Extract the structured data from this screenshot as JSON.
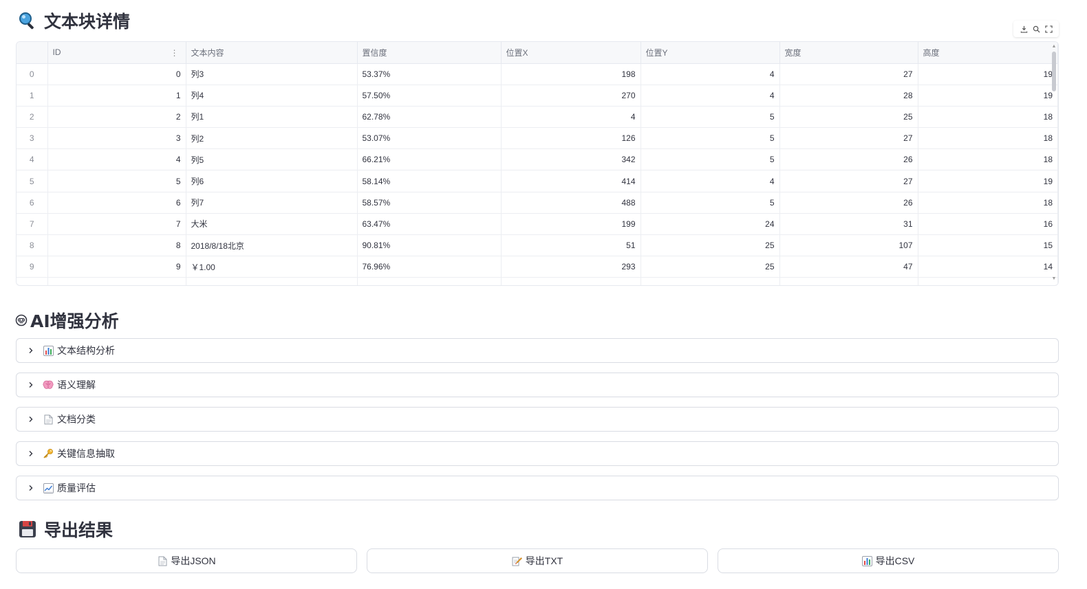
{
  "sections": {
    "blocks_title": "文本块详情",
    "ai_title": "AI增强分析",
    "export_title": "导出结果"
  },
  "table": {
    "columns": [
      "ID",
      "文本内容",
      "置信度",
      "位置X",
      "位置Y",
      "宽度",
      "高度"
    ],
    "rows": [
      {
        "index": "0",
        "id": "0",
        "text": "列3",
        "confidence": "53.37%",
        "x": "198",
        "y": "4",
        "w": "27",
        "h": "19"
      },
      {
        "index": "1",
        "id": "1",
        "text": "列4",
        "confidence": "57.50%",
        "x": "270",
        "y": "4",
        "w": "28",
        "h": "19"
      },
      {
        "index": "2",
        "id": "2",
        "text": "列1",
        "confidence": "62.78%",
        "x": "4",
        "y": "5",
        "w": "25",
        "h": "18"
      },
      {
        "index": "3",
        "id": "3",
        "text": "列2",
        "confidence": "53.07%",
        "x": "126",
        "y": "5",
        "w": "27",
        "h": "18"
      },
      {
        "index": "4",
        "id": "4",
        "text": "列5",
        "confidence": "66.21%",
        "x": "342",
        "y": "5",
        "w": "26",
        "h": "18"
      },
      {
        "index": "5",
        "id": "5",
        "text": "列6",
        "confidence": "58.14%",
        "x": "414",
        "y": "4",
        "w": "27",
        "h": "19"
      },
      {
        "index": "6",
        "id": "6",
        "text": "列7",
        "confidence": "58.57%",
        "x": "488",
        "y": "5",
        "w": "26",
        "h": "18"
      },
      {
        "index": "7",
        "id": "7",
        "text": "大米",
        "confidence": "63.47%",
        "x": "199",
        "y": "24",
        "w": "31",
        "h": "16"
      },
      {
        "index": "8",
        "id": "8",
        "text": "2018/8/18北京",
        "confidence": "90.81%",
        "x": "51",
        "y": "25",
        "w": "107",
        "h": "15"
      },
      {
        "index": "9",
        "id": "9",
        "text": "￥1.00",
        "confidence": "76.96%",
        "x": "293",
        "y": "25",
        "w": "47",
        "h": "14"
      }
    ]
  },
  "expanders": [
    {
      "label": "文本结构分析",
      "icon": "bar-chart-icon"
    },
    {
      "label": "语义理解",
      "icon": "brain-icon"
    },
    {
      "label": "文档分类",
      "icon": "document-icon"
    },
    {
      "label": "关键信息抽取",
      "icon": "key-icon"
    },
    {
      "label": "质量评估",
      "icon": "trend-chart-icon"
    }
  ],
  "export_buttons": [
    {
      "label": "导出JSON",
      "icon": "document-icon"
    },
    {
      "label": "导出TXT",
      "icon": "memo-icon"
    },
    {
      "label": "导出CSV",
      "icon": "bar-chart-icon"
    }
  ],
  "colors": {
    "text": "#31333f",
    "border": "#d9dce3",
    "header_bg": "#f7f8fa"
  }
}
